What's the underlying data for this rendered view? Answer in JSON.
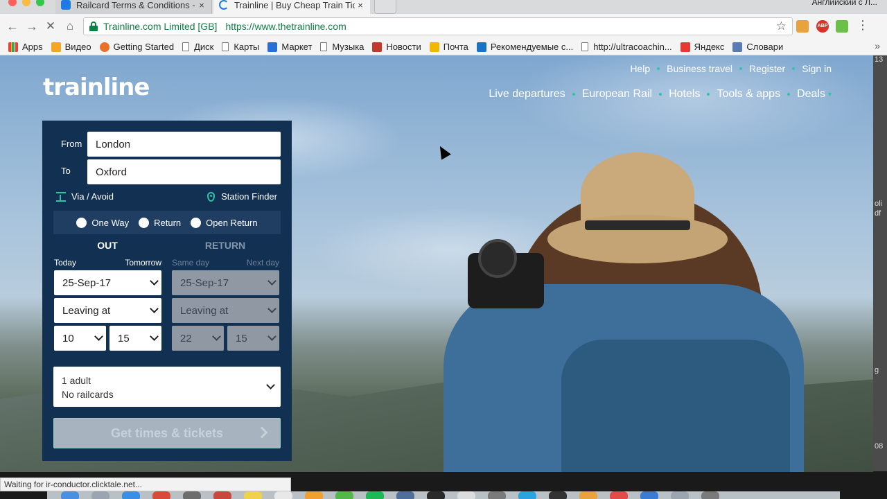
{
  "browser": {
    "tabs": [
      {
        "title": "Railcard Terms & Conditions -",
        "close": "×"
      },
      {
        "title": "Trainline | Buy Cheap Train Tic",
        "close": "×"
      }
    ],
    "profile": "Английский с Л...",
    "ev_name": "Trainline.com Limited [GB]",
    "url": "https://www.thetrainline.com",
    "extensions": {
      "abp": "ABP"
    },
    "bookmarks": [
      "Apps",
      "Видео",
      "Getting Started",
      "Диск",
      "Карты",
      "Маркет",
      "Музыка",
      "Новости",
      "Почта",
      "Рекомендуемые с...",
      "http://ultracoachin...",
      "Яндекс",
      "Словари"
    ],
    "status": "Waiting for ir-conductor.clicktale.net..."
  },
  "site": {
    "logo": "trainline",
    "top_nav": [
      "Help",
      "Business travel",
      "Register",
      "Sign in"
    ],
    "main_nav": [
      "Live departures",
      "European Rail",
      "Hotels",
      "Tools & apps",
      "Deals"
    ]
  },
  "search": {
    "from_label": "From",
    "from_value": "London",
    "to_label": "To",
    "to_value": "Oxford",
    "via_avoid": "Via / Avoid",
    "station_finder": "Station Finder",
    "journey_types": [
      "One Way",
      "Return",
      "Open Return"
    ],
    "out": {
      "heading": "OUT",
      "quick_left": "Today",
      "quick_right": "Tomorrow",
      "date": "25-Sep-17",
      "time_mode": "Leaving at",
      "hour": "10",
      "minute": "15"
    },
    "return": {
      "heading": "RETURN",
      "quick_left": "Same day",
      "quick_right": "Next day",
      "date": "25-Sep-17",
      "time_mode": "Leaving at",
      "hour": "22",
      "minute": "15"
    },
    "passengers": {
      "line1": "1 adult",
      "line2": "No railcards"
    },
    "submit": "Get times & tickets"
  },
  "side_strip": [
    "13",
    "oli",
    "df",
    "g",
    "08"
  ],
  "colors": {
    "navy": "#123052",
    "teal": "#2dc4a8",
    "ev_green": "#0b8043"
  }
}
